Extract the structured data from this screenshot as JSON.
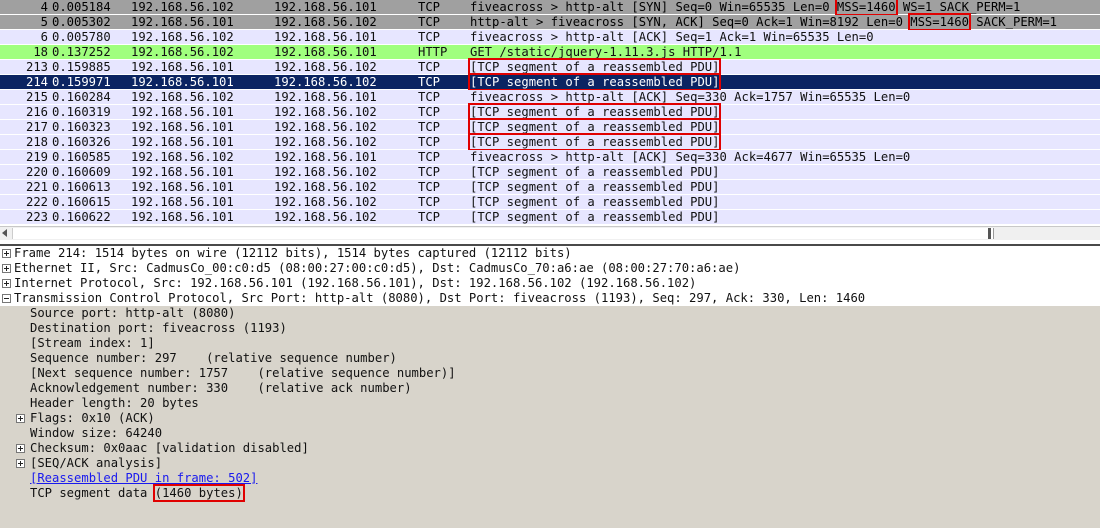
{
  "packets": [
    {
      "no": "4",
      "time": "0.005184",
      "src": "192.168.56.102",
      "dst": "192.168.56.101",
      "proto": "TCP",
      "info_pre": "fiveacross > http-alt [SYN] Seq=0 Win=65535 Len=0 ",
      "info_hl": "MSS=1460",
      "info_post": " WS=1 SACK_PERM=1",
      "style": "syn"
    },
    {
      "no": "5",
      "time": "0.005302",
      "src": "192.168.56.101",
      "dst": "192.168.56.102",
      "proto": "TCP",
      "info_pre": "http-alt > fiveacross [SYN, ACK] Seq=0 Ack=1 Win=8192 Len=0 ",
      "info_hl": "MSS=1460",
      "info_post": " SACK_PERM=1",
      "style": "syn"
    },
    {
      "no": "6",
      "time": "0.005780",
      "src": "192.168.56.102",
      "dst": "192.168.56.101",
      "proto": "TCP",
      "info_pre": "fiveacross > http-alt [ACK] Seq=1 Ack=1 Win=65535 Len=0",
      "info_hl": "",
      "info_post": "",
      "style": "tcp"
    },
    {
      "no": "18",
      "time": "0.137252",
      "src": "192.168.56.102",
      "dst": "192.168.56.101",
      "proto": "HTTP",
      "info_pre": "GET /static/jquery-1.11.3.js HTTP/1.1",
      "info_hl": "",
      "info_post": "",
      "style": "http"
    },
    {
      "no": "213",
      "time": "0.159885",
      "src": "192.168.56.101",
      "dst": "192.168.56.102",
      "proto": "TCP",
      "info_pre": "",
      "info_hl": "[TCP segment of a reassembled PDU]",
      "info_post": "",
      "style": "tcp"
    },
    {
      "no": "214",
      "time": "0.159971",
      "src": "192.168.56.101",
      "dst": "192.168.56.102",
      "proto": "TCP",
      "info_pre": "",
      "info_hl": "[TCP segment of a reassembled PDU]",
      "info_post": "",
      "style": "sel"
    },
    {
      "no": "215",
      "time": "0.160284",
      "src": "192.168.56.102",
      "dst": "192.168.56.101",
      "proto": "TCP",
      "info_pre": "fiveacross > http-alt [ACK] Seq=330 Ack=1757 Win=65535 Len=0",
      "info_hl": "",
      "info_post": "",
      "style": "tcp"
    },
    {
      "no": "216",
      "time": "0.160319",
      "src": "192.168.56.101",
      "dst": "192.168.56.102",
      "proto": "TCP",
      "info_pre": "",
      "info_hl": "[TCP segment of a reassembled PDU]",
      "info_post": "",
      "style": "tcp"
    },
    {
      "no": "217",
      "time": "0.160323",
      "src": "192.168.56.101",
      "dst": "192.168.56.102",
      "proto": "TCP",
      "info_pre": "",
      "info_hl": "[TCP segment of a reassembled PDU]",
      "info_post": "",
      "style": "tcp"
    },
    {
      "no": "218",
      "time": "0.160326",
      "src": "192.168.56.101",
      "dst": "192.168.56.102",
      "proto": "TCP",
      "info_pre": "",
      "info_hl": "[TCP segment of a reassembled PDU]",
      "info_post": "",
      "style": "tcp"
    },
    {
      "no": "219",
      "time": "0.160585",
      "src": "192.168.56.102",
      "dst": "192.168.56.101",
      "proto": "TCP",
      "info_pre": "fiveacross > http-alt [ACK] Seq=330 Ack=4677 Win=65535 Len=0",
      "info_hl": "",
      "info_post": "",
      "style": "tcp"
    },
    {
      "no": "220",
      "time": "0.160609",
      "src": "192.168.56.101",
      "dst": "192.168.56.102",
      "proto": "TCP",
      "info_pre": "[TCP segment of a reassembled PDU]",
      "info_hl": "",
      "info_post": "",
      "style": "tcp"
    },
    {
      "no": "221",
      "time": "0.160613",
      "src": "192.168.56.101",
      "dst": "192.168.56.102",
      "proto": "TCP",
      "info_pre": "[TCP segment of a reassembled PDU]",
      "info_hl": "",
      "info_post": "",
      "style": "tcp"
    },
    {
      "no": "222",
      "time": "0.160615",
      "src": "192.168.56.101",
      "dst": "192.168.56.102",
      "proto": "TCP",
      "info_pre": "[TCP segment of a reassembled PDU]",
      "info_hl": "",
      "info_post": "",
      "style": "tcp"
    },
    {
      "no": "223",
      "time": "0.160622",
      "src": "192.168.56.101",
      "dst": "192.168.56.102",
      "proto": "TCP",
      "info_pre": "[TCP segment of a reassembled PDU]",
      "info_hl": "",
      "info_post": "",
      "style": "tcp"
    }
  ],
  "details": {
    "frame": "Frame 214: 1514 bytes on wire (12112 bits), 1514 bytes captured (12112 bits)",
    "ethernet": "Ethernet II, Src: CadmusCo_00:c0:d5 (08:00:27:00:c0:d5), Dst: CadmusCo_70:a6:ae (08:00:27:70:a6:ae)",
    "ip": "Internet Protocol, Src: 192.168.56.101 (192.168.56.101), Dst: 192.168.56.102 (192.168.56.102)",
    "tcp": "Transmission Control Protocol, Src Port: http-alt (8080), Dst Port: fiveacross (1193), Seq: 297, Ack: 330, Len: 1460",
    "source_port": "Source port: http-alt (8080)",
    "destination_port": "Destination port: fiveacross (1193)",
    "stream_index": "[Stream index: 1]",
    "sequence_number": "Sequence number: 297    (relative sequence number)",
    "next_sequence": "[Next sequence number: 1757    (relative sequence number)]",
    "ack_number": "Acknowledgement number: 330    (relative ack number)",
    "header_length": "Header length: 20 bytes",
    "flags": "Flags: 0x10 (ACK)",
    "window_size": "Window size: 64240",
    "checksum": "Checksum: 0x0aac [validation disabled]",
    "seq_ack": "[SEQ/ACK analysis]",
    "reassembled": "[Reassembled PDU in frame: 502]",
    "segment_data_pre": "TCP segment data ",
    "segment_data_hl": "(1460 bytes)"
  },
  "colors": {
    "syn_row": "#a0a0a0",
    "tcp_row": "#e7e6ff",
    "http_row": "#a0ff7e",
    "selected_row": "#0b2462",
    "highlight_box": "#e00000",
    "details_bg": "#d8d4cb"
  }
}
